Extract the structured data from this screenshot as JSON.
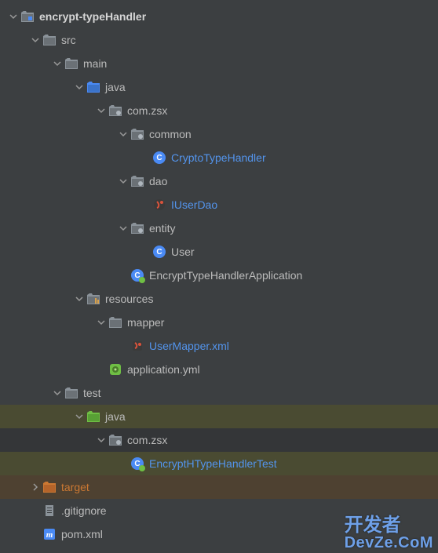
{
  "tree": [
    {
      "depth": 0,
      "arrow": "down",
      "icon": "module",
      "label": "encrypt-typeHandler",
      "style": "bold",
      "name": "module-encrypt-typehandler",
      "hl": ""
    },
    {
      "depth": 1,
      "arrow": "down",
      "icon": "folder",
      "label": "src",
      "style": "",
      "name": "folder-src",
      "hl": ""
    },
    {
      "depth": 2,
      "arrow": "down",
      "icon": "folder",
      "label": "main",
      "style": "",
      "name": "folder-main",
      "hl": ""
    },
    {
      "depth": 3,
      "arrow": "down",
      "icon": "folder-src",
      "label": "java",
      "style": "",
      "name": "folder-main-java",
      "hl": ""
    },
    {
      "depth": 4,
      "arrow": "down",
      "icon": "package",
      "label": "com.zsx",
      "style": "",
      "name": "package-com-zsx",
      "hl": ""
    },
    {
      "depth": 5,
      "arrow": "down",
      "icon": "package",
      "label": "common",
      "style": "",
      "name": "package-common",
      "hl": ""
    },
    {
      "depth": 6,
      "arrow": "none",
      "icon": "class",
      "label": "CryptoTypeHandler",
      "style": "link",
      "name": "file-cryptotypehandler",
      "hl": ""
    },
    {
      "depth": 5,
      "arrow": "down",
      "icon": "package",
      "label": "dao",
      "style": "",
      "name": "package-dao",
      "hl": ""
    },
    {
      "depth": 6,
      "arrow": "none",
      "icon": "interface",
      "label": "IUserDao",
      "style": "link",
      "name": "file-iuserdao",
      "hl": ""
    },
    {
      "depth": 5,
      "arrow": "down",
      "icon": "package",
      "label": "entity",
      "style": "",
      "name": "package-entity",
      "hl": ""
    },
    {
      "depth": 6,
      "arrow": "none",
      "icon": "class",
      "label": "User",
      "style": "",
      "name": "file-user",
      "hl": ""
    },
    {
      "depth": 5,
      "arrow": "none",
      "icon": "class-run",
      "label": "EncryptTypeHandlerApplication",
      "style": "",
      "name": "file-encrypt-app",
      "hl": ""
    },
    {
      "depth": 3,
      "arrow": "down",
      "icon": "folder-res",
      "label": "resources",
      "style": "",
      "name": "folder-resources",
      "hl": ""
    },
    {
      "depth": 4,
      "arrow": "down",
      "icon": "folder",
      "label": "mapper",
      "style": "",
      "name": "folder-mapper",
      "hl": ""
    },
    {
      "depth": 5,
      "arrow": "none",
      "icon": "xml-red",
      "label": "UserMapper.xml",
      "style": "link",
      "name": "file-usermapper-xml",
      "hl": ""
    },
    {
      "depth": 4,
      "arrow": "none",
      "icon": "yml",
      "label": "application.yml",
      "style": "",
      "name": "file-application-yml",
      "hl": ""
    },
    {
      "depth": 2,
      "arrow": "down",
      "icon": "folder",
      "label": "test",
      "style": "",
      "name": "folder-test",
      "hl": ""
    },
    {
      "depth": 3,
      "arrow": "down",
      "icon": "folder-test",
      "label": "java",
      "style": "",
      "name": "folder-test-java",
      "hl": "olive"
    },
    {
      "depth": 4,
      "arrow": "down",
      "icon": "package",
      "label": "com.zsx",
      "style": "",
      "name": "package-test-com-zsx",
      "hl": "dark"
    },
    {
      "depth": 5,
      "arrow": "none",
      "icon": "class-run",
      "label": "EncryptHTypeHandlerTest",
      "style": "link",
      "name": "file-encrypt-test",
      "hl": "olive"
    },
    {
      "depth": 1,
      "arrow": "right",
      "icon": "folder-excl",
      "label": "target",
      "style": "target",
      "name": "folder-target",
      "hl": "orange"
    },
    {
      "depth": 1,
      "arrow": "none",
      "icon": "gitignore",
      "label": ".gitignore",
      "style": "",
      "name": "file-gitignore",
      "hl": ""
    },
    {
      "depth": 1,
      "arrow": "none",
      "icon": "maven",
      "label": "pom.xml",
      "style": "",
      "name": "file-pom-xml",
      "hl": ""
    }
  ],
  "watermark": {
    "line1": "开发者",
    "line2": "DevZe.CoM"
  }
}
